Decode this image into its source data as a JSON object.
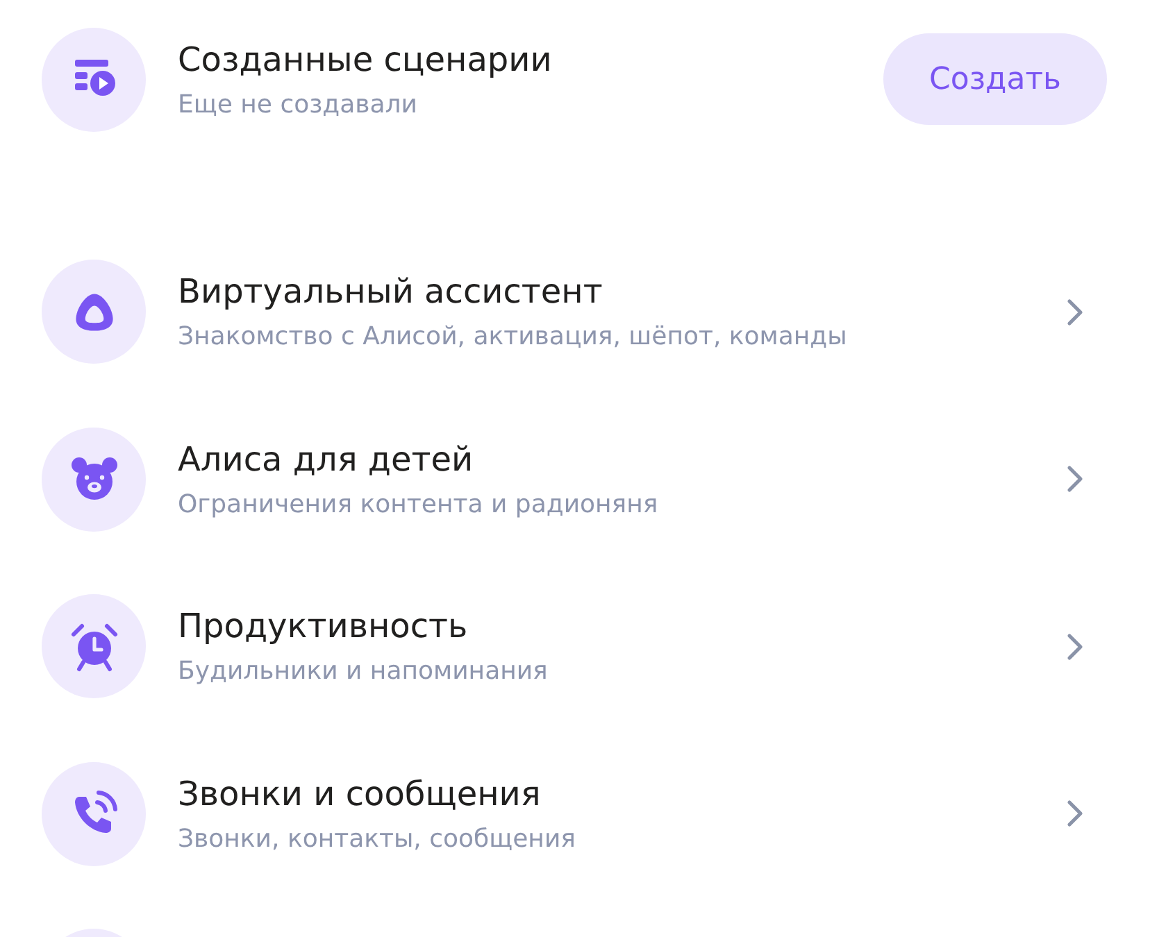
{
  "scenarios": {
    "title": "Созданные сценарии",
    "subtitle": "Еще не создавали",
    "button": "Создать"
  },
  "items": [
    {
      "title": "Виртуальный ассистент",
      "subtitle": "Знакомство с Алисой, активация, шёпот, команды"
    },
    {
      "title": "Алиса для детей",
      "subtitle": "Ограничения контента и радионяня"
    },
    {
      "title": "Продуктивность",
      "subtitle": "Будильники и напоминания"
    },
    {
      "title": "Звонки и сообщения",
      "subtitle": "Звонки, контакты, сообщения"
    }
  ]
}
